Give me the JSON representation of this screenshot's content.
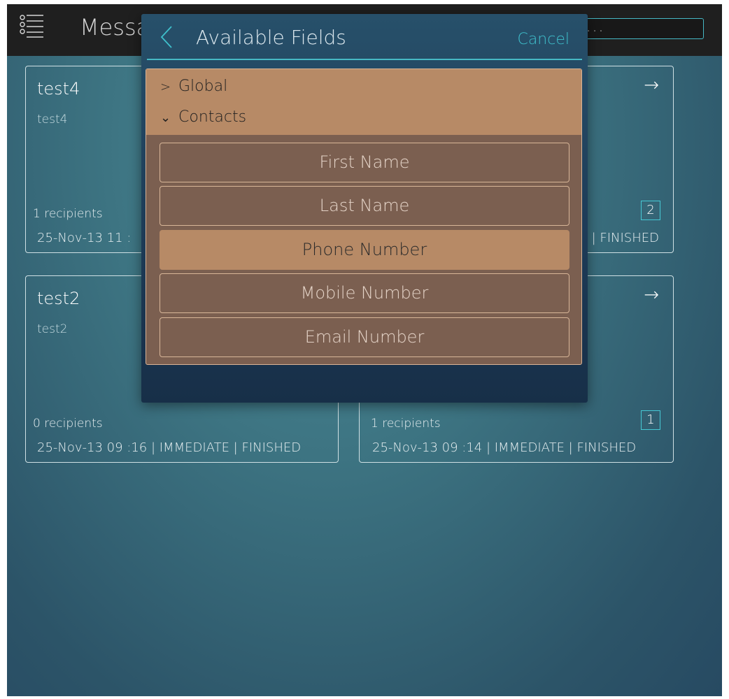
{
  "header": {
    "app_title": "Messa",
    "search_placeholder": ". . ."
  },
  "cards": [
    {
      "title": "test4",
      "subtitle": "test4",
      "recipients": "1 recipients",
      "meta": "25-Nov-13 11 :"
    },
    {
      "meta": "| FINISHED",
      "badge": "2"
    },
    {
      "title": "test2",
      "subtitle": "test2",
      "recipients": "0 recipients",
      "meta": "25-Nov-13 09 :16 | IMMEDIATE | FINISHED"
    },
    {
      "recipients": "1 recipients",
      "meta": "25-Nov-13 09 :14 | IMMEDIATE | FINISHED",
      "badge": "1"
    }
  ],
  "modal": {
    "title": "Available Fields",
    "cancel_label": "Cancel",
    "groups": [
      {
        "label": "Global",
        "expanded": false
      },
      {
        "label": "Contacts",
        "expanded": true
      }
    ],
    "fields": [
      {
        "label": "First Name",
        "selected": false
      },
      {
        "label": "Last Name",
        "selected": false
      },
      {
        "label": "Phone Number",
        "selected": true
      },
      {
        "label": "Mobile Number",
        "selected": false
      },
      {
        "label": "Email Number",
        "selected": false
      }
    ]
  },
  "colors": {
    "accent": "#46b8c4",
    "selected_field": "#b78a66",
    "panel_bg": "#7b5f50"
  },
  "icons": {
    "menu": "list-icon",
    "back": "chevron-left-icon",
    "arrow": "arrow-right-icon",
    "collapsed": "chevron-right-icon",
    "expanded": "chevron-down-icon"
  }
}
